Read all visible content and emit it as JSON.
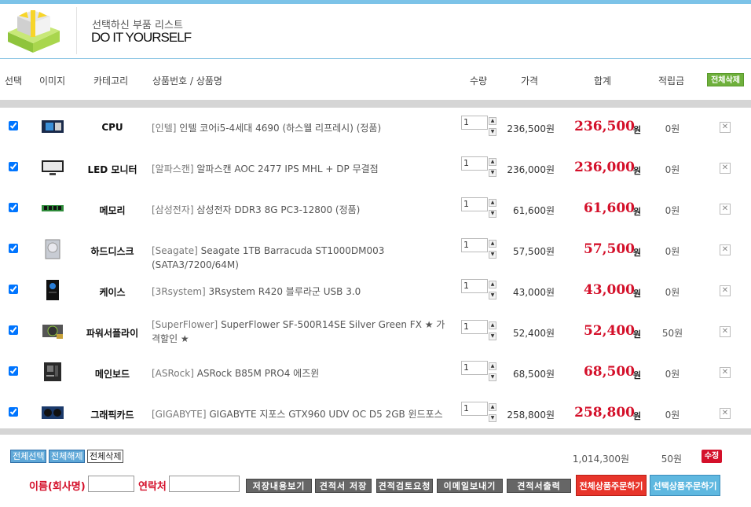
{
  "header": {
    "subtitle": "선택하신 부품 리스트",
    "title": "DO IT YOURSELF"
  },
  "columns": {
    "select": "선택",
    "image": "이미지",
    "category": "카테고리",
    "product": "상품번호 / 상품명",
    "qty": "수량",
    "price": "가격",
    "total": "합계",
    "points": "적립금",
    "delete_all": "전체삭제"
  },
  "rows": [
    {
      "checked": true,
      "icon": "cpu-icon",
      "category": "CPU",
      "brand": "[인텔]",
      "name": "인텔 코어i5-4세대 4690 (하스웰 리프레시) (정품)",
      "qty": "1",
      "price": "236,500원",
      "total": "236,500",
      "total_unit": "원",
      "points": "0원"
    },
    {
      "checked": true,
      "icon": "monitor-icon",
      "category": "LED 모니터",
      "brand": "[알파스캔]",
      "name": "알파스캔 AOC 2477 IPS MHL + DP 무결점",
      "qty": "1",
      "price": "236,000원",
      "total": "236,000",
      "total_unit": "원",
      "points": "0원"
    },
    {
      "checked": true,
      "icon": "ram-icon",
      "category": "메모리",
      "brand": "[삼성전자]",
      "name": "삼성전자 DDR3 8G PC3-12800 (정품)",
      "qty": "1",
      "price": "61,600원",
      "total": "61,600",
      "total_unit": "원",
      "points": "0원"
    },
    {
      "checked": true,
      "icon": "hdd-icon",
      "category": "하드디스크",
      "brand": "[Seagate]",
      "name": "Seagate 1TB Barracuda ST1000DM003 (SATA3/7200/64M)",
      "qty": "1",
      "price": "57,500원",
      "total": "57,500",
      "total_unit": "원",
      "points": "0원"
    },
    {
      "checked": true,
      "icon": "case-icon",
      "category": "케이스",
      "brand": "[3Rsystem]",
      "name": "3Rsystem R420 블루라군 USB 3.0",
      "qty": "1",
      "price": "43,000원",
      "total": "43,000",
      "total_unit": "원",
      "points": "0원"
    },
    {
      "checked": true,
      "icon": "psu-icon",
      "category": "파워서플라이",
      "brand": "[SuperFlower]",
      "name": "SuperFlower SF-500R14SE Silver Green FX ★ 가격할인 ★",
      "qty": "1",
      "price": "52,400원",
      "total": "52,400",
      "total_unit": "원",
      "points": "50원"
    },
    {
      "checked": true,
      "icon": "mainboard-icon",
      "category": "메인보드",
      "brand": "[ASRock]",
      "name": "ASRock B85M PRO4 에즈윈",
      "qty": "1",
      "price": "68,500원",
      "total": "68,500",
      "total_unit": "원",
      "points": "0원"
    },
    {
      "checked": true,
      "icon": "gpu-icon",
      "category": "그래픽카드",
      "brand": "[GIGABYTE]",
      "name": "GIGABYTE 지포스 GTX960 UDV OC D5 2GB 윈드포스",
      "qty": "1",
      "price": "258,800원",
      "total": "258,800",
      "total_unit": "원",
      "points": "0원"
    }
  ],
  "footer": {
    "select_all": "전체선택",
    "deselect_all": "전체해제",
    "delete_all": "전체삭제",
    "grand_total": "1,014,300원",
    "total_points": "50원",
    "edit": "수정",
    "name_label": "이름(회사명)",
    "contact_label": "연락처",
    "btn_view_saved": "저장내용보기",
    "btn_save_quote": "견적서 저장",
    "btn_review": "견적검토요청",
    "btn_email": "이메일보내기",
    "btn_print": "견적서출력",
    "btn_order_all": "전체상품주문하기",
    "btn_order_selected": "선택상품주문하기"
  },
  "colors": {
    "accent_red": "#d4102a",
    "accent_blue": "#5fb8e0",
    "accent_green": "#6fb03c"
  }
}
